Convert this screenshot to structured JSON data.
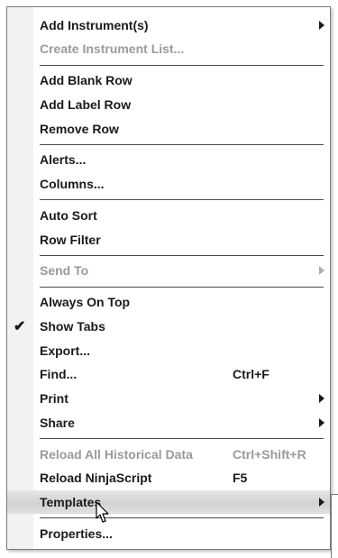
{
  "menu": {
    "add_instruments": "Add Instrument(s)",
    "create_instrument_list": "Create Instrument List...",
    "add_blank_row": "Add Blank Row",
    "add_label_row": "Add Label Row",
    "remove_row": "Remove Row",
    "alerts": "Alerts...",
    "columns": "Columns...",
    "auto_sort": "Auto Sort",
    "row_filter": "Row Filter",
    "send_to": "Send To",
    "always_on_top": "Always On Top",
    "show_tabs": "Show Tabs",
    "show_tabs_checked": true,
    "export": "Export...",
    "find": "Find...",
    "find_shortcut": "Ctrl+F",
    "print": "Print",
    "share": "Share",
    "reload_historical": "Reload All Historical Data",
    "reload_historical_shortcut": "Ctrl+Shift+R",
    "reload_ninjascript": "Reload NinjaScript",
    "reload_ninjascript_shortcut": "F5",
    "templates": "Templates",
    "properties": "Properties..."
  },
  "icons": {
    "check": "checkmark-icon",
    "submenu": "submenu-arrow-icon",
    "cursor": "mouse-pointer-icon"
  },
  "colors": {
    "text": "#1a1a1a",
    "disabled_text": "#9a9a9a",
    "hover_bg": "#d8d8d8"
  }
}
